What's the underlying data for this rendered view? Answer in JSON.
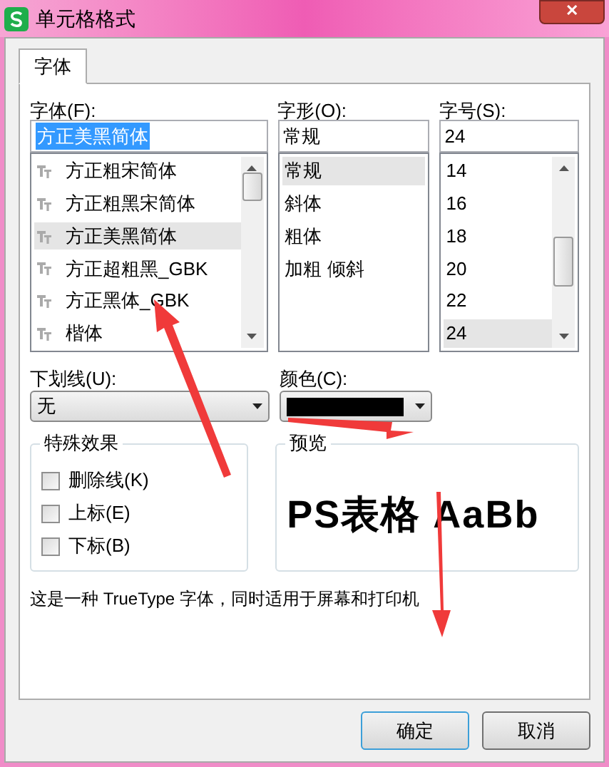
{
  "window": {
    "title": "单元格格式",
    "close": "✕"
  },
  "tabs": [
    {
      "label": "字体",
      "selected": true
    }
  ],
  "font": {
    "label": "字体(F):",
    "value": "方正美黑简体",
    "items": [
      {
        "label": "方正粗宋简体",
        "selected": false
      },
      {
        "label": "方正粗黑宋简体",
        "selected": false
      },
      {
        "label": "方正美黑简体",
        "selected": true
      },
      {
        "label": "方正超粗黑_GBK",
        "selected": false
      },
      {
        "label": "方正黑体_GBK",
        "selected": false
      },
      {
        "label": "楷体",
        "selected": false
      }
    ]
  },
  "style": {
    "label": "字形(O):",
    "value": "常规",
    "items": [
      {
        "label": "常规",
        "selected": true
      },
      {
        "label": "斜体",
        "selected": false
      },
      {
        "label": "粗体",
        "selected": false
      },
      {
        "label": "加粗 倾斜",
        "selected": false
      }
    ]
  },
  "size": {
    "label": "字号(S):",
    "value": "24",
    "items": [
      {
        "label": "14",
        "selected": false
      },
      {
        "label": "16",
        "selected": false
      },
      {
        "label": "18",
        "selected": false
      },
      {
        "label": "20",
        "selected": false
      },
      {
        "label": "22",
        "selected": false
      },
      {
        "label": "24",
        "selected": true
      }
    ]
  },
  "underline": {
    "label": "下划线(U):",
    "value": "无"
  },
  "color_picker": {
    "label": "颜色(C):",
    "color": "#000000"
  },
  "effects": {
    "title": "特殊效果",
    "items": [
      {
        "label": "删除线(K)",
        "checked": false
      },
      {
        "label": "上标(E)",
        "checked": false
      },
      {
        "label": "下标(B)",
        "checked": false
      }
    ]
  },
  "preview": {
    "title": "预览",
    "text": "PS表格 AaBb"
  },
  "description": "这是一种 TrueType 字体，同时适用于屏幕和打印机",
  "buttons": [
    "确定",
    "取消"
  ]
}
